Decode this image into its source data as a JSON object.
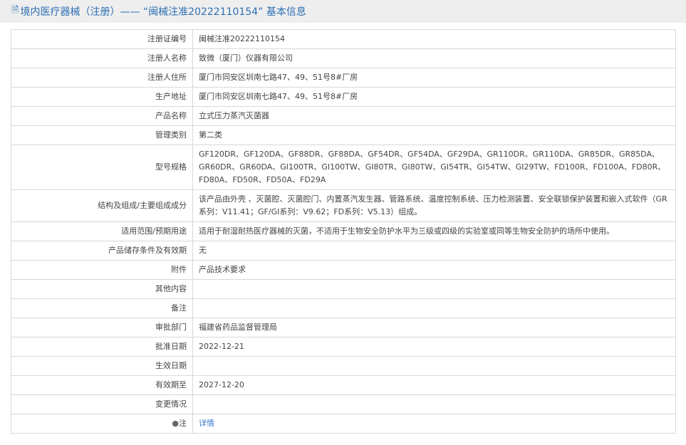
{
  "header": {
    "title": "境内医疗器械（注册）—— “闽械注准20222110154” 基本信息"
  },
  "rows": [
    {
      "label": "注册证编号",
      "value": "闽械注准20222110154"
    },
    {
      "label": "注册人名称",
      "value": "致微（厦门）仪器有限公司"
    },
    {
      "label": "注册人住所",
      "value": "厦门市同安区圳南七路47、49、51号8#厂房"
    },
    {
      "label": "生产地址",
      "value": "厦门市同安区圳南七路47、49、51号8#厂房"
    },
    {
      "label": "产品名称",
      "value": "立式压力蒸汽灭菌器"
    },
    {
      "label": "管理类别",
      "value": "第二类"
    },
    {
      "label": "型号规格",
      "value": "GF120DR、GF120DA、GF88DR、GF88DA、GF54DR、GF54DA、GF29DA、GR110DR、GR110DA、GR85DR、GR85DA、GR60DR、GR60DA、GI100TR、GI100TW、GI80TR、GI80TW、GI54TR、GI54TW、GI29TW、FD100R、FD100A、FD80R、FD80A、FD50R、FD50A、FD29A"
    },
    {
      "label": "结构及组成/主要组成成分",
      "value": "该产品由外壳 、灭菌腔、灭菌腔门、内置蒸汽发生器、管路系统、温度控制系统、压力检测装置、安全联锁保护装置和嵌入式软件（GR系列：V11.41；GF/GI系列：V9.62；FD系列：V5.13）组成。"
    },
    {
      "label": "适用范围/预期用途",
      "value": "适用于耐湿耐热医疗器械的灭菌，不适用于生物安全防护水平为三级或四级的实验室或同等生物安全防护的场所中使用。"
    },
    {
      "label": "产品储存条件及有效期",
      "value": "无"
    },
    {
      "label": "附件",
      "value": "产品技术要求"
    },
    {
      "label": "其他内容",
      "value": ""
    },
    {
      "label": "备注",
      "value": ""
    },
    {
      "label": "审批部门",
      "value": "福建省药品监督管理局"
    },
    {
      "label": "批准日期",
      "value": "2022-12-21"
    },
    {
      "label": "生效日期",
      "value": ""
    },
    {
      "label": "有效期至",
      "value": "2027-12-20"
    },
    {
      "label": "变更情况",
      "value": ""
    }
  ],
  "note": {
    "label": "注",
    "link": "详情"
  }
}
